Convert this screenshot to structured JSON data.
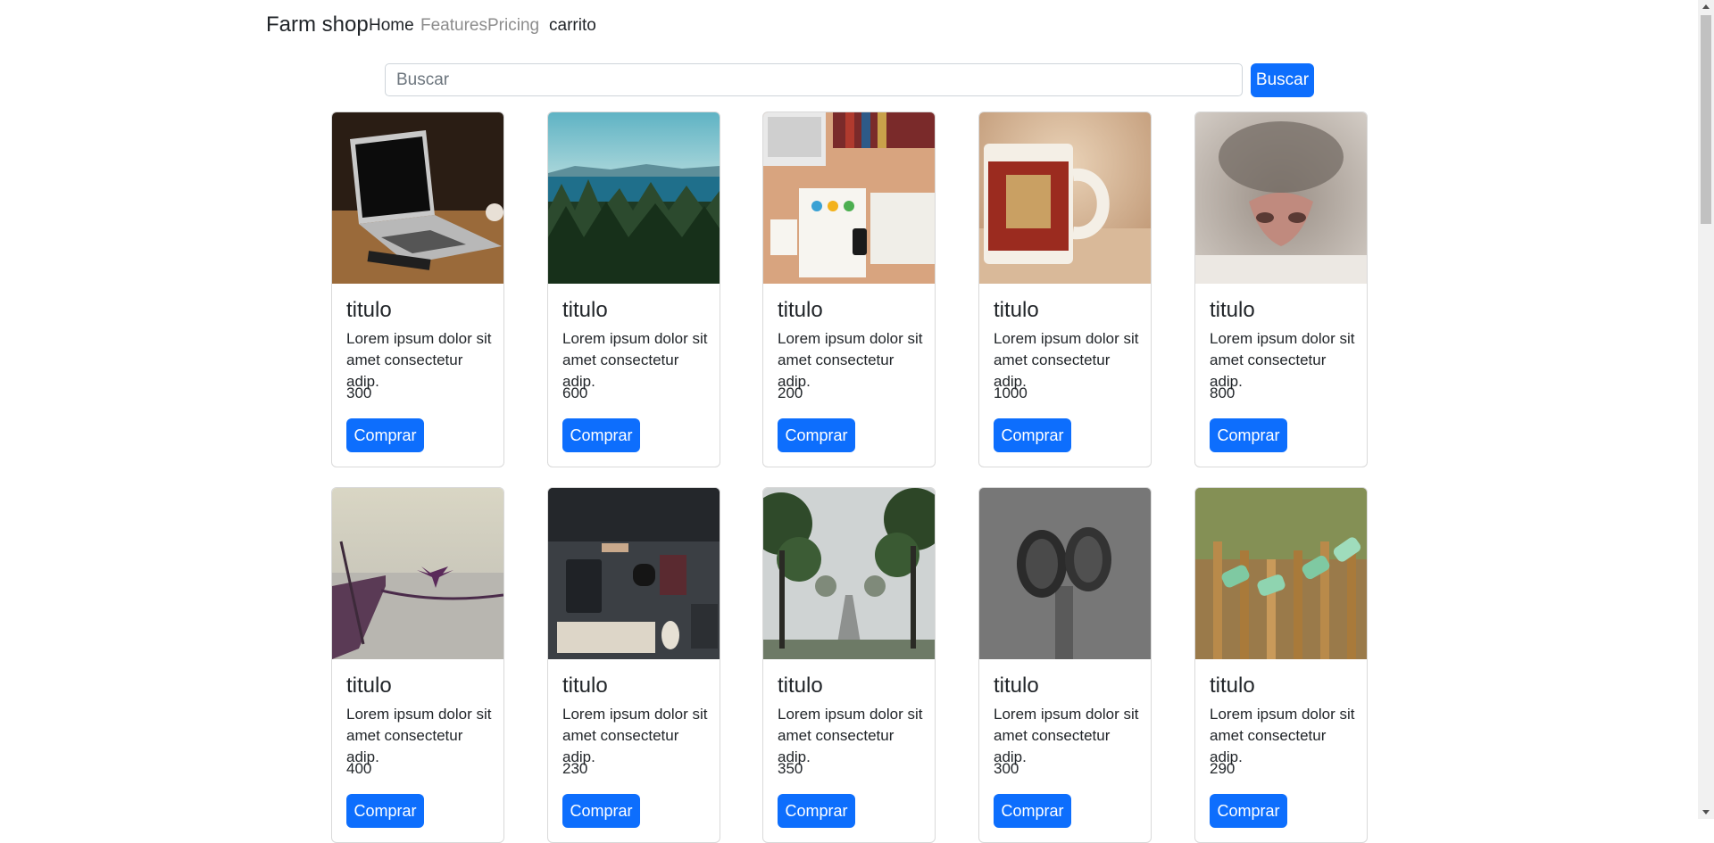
{
  "navbar": {
    "brand": "Farm shop",
    "links": [
      {
        "label": "Home",
        "state": "active"
      },
      {
        "label": "Features",
        "state": "muted"
      },
      {
        "label": "Pricing",
        "state": "muted"
      },
      {
        "label": "carrito",
        "state": "active"
      }
    ]
  },
  "search": {
    "placeholder": "Buscar",
    "value": "",
    "button_label": "Buscar"
  },
  "products": [
    {
      "image": "laptop-on-desk",
      "title": "titulo",
      "description": "Lorem ipsum dolor sit amet consectetur adip.",
      "price": "300",
      "button": "Comprar"
    },
    {
      "image": "forest-and-lake",
      "title": "titulo",
      "description": "Lorem ipsum dolor sit amet consectetur adip.",
      "price": "600",
      "button": "Comprar"
    },
    {
      "image": "desk-flatlay",
      "title": "titulo",
      "description": "Lorem ipsum dolor sit amet consectetur adip.",
      "price": "200",
      "button": "Comprar"
    },
    {
      "image": "mug",
      "title": "titulo",
      "description": "Lorem ipsum dolor sit amet consectetur adip.",
      "price": "1000",
      "button": "Comprar"
    },
    {
      "image": "cat-nose",
      "title": "titulo",
      "description": "Lorem ipsum dolor sit amet consectetur adip.",
      "price": "800",
      "button": "Comprar"
    },
    {
      "image": "boat-and-bird",
      "title": "titulo",
      "description": "Lorem ipsum dolor sit amet consectetur adip.",
      "price": "400",
      "button": "Comprar"
    },
    {
      "image": "workspace-keyboard",
      "title": "titulo",
      "description": "Lorem ipsum dolor sit amet consectetur adip.",
      "price": "230",
      "button": "Comprar"
    },
    {
      "image": "foggy-road",
      "title": "titulo",
      "description": "Lorem ipsum dolor sit amet consectetur adip.",
      "price": "350",
      "button": "Comprar"
    },
    {
      "image": "pine-cones",
      "title": "titulo",
      "description": "Lorem ipsum dolor sit amet consectetur adip.",
      "price": "300",
      "button": "Comprar"
    },
    {
      "image": "bottles-fence",
      "title": "titulo",
      "description": "Lorem ipsum dolor sit amet consectetur adip.",
      "price": "290",
      "button": "Comprar"
    }
  ],
  "colors": {
    "primary": "#0d6efd",
    "text": "#212529",
    "muted": "#8c8c8c"
  }
}
